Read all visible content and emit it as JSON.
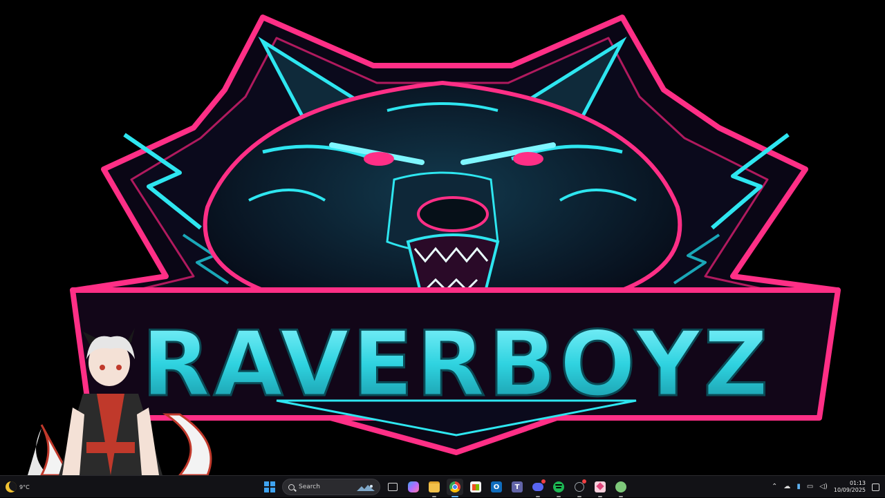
{
  "wallpaper": {
    "logo_text": "RAVERBOYZ",
    "colors": {
      "neon_pink": "#ff2f86",
      "neon_cyan": "#31e6ef",
      "background": "#000000"
    }
  },
  "taskbar": {
    "weather": {
      "temp": "9°C",
      "icon": "moon-icon"
    },
    "start_icon": "windows-logo-icon",
    "search": {
      "placeholder": "Search"
    },
    "apps": [
      {
        "name": "task-view-icon",
        "color": "#d9d9d9"
      },
      {
        "name": "copilot-icon",
        "color": "#7b6cff"
      },
      {
        "name": "file-explorer-icon",
        "color": "#f2c14a"
      },
      {
        "name": "chrome-icon",
        "color": "#34a853"
      },
      {
        "name": "microsoft-store-icon",
        "color": "#2d8cff"
      },
      {
        "name": "outlook-icon",
        "color": "#0f6cbd"
      },
      {
        "name": "teams-icon",
        "color": "#6264a7"
      },
      {
        "name": "discord-icon",
        "color": "#5865f2"
      },
      {
        "name": "spotify-icon",
        "color": "#1db954"
      },
      {
        "name": "clock-app-icon",
        "color": "#9aa0a6"
      },
      {
        "name": "paint-icon",
        "color": "#f4b6c8"
      },
      {
        "name": "xbox-icon",
        "color": "#7ec87a"
      }
    ],
    "tray": {
      "chevron_icon": "chevron-up-icon",
      "cloud_icon": "onedrive-icon",
      "mic_icon": "microphone-icon",
      "network_icon": "network-icon",
      "volume_icon": "speaker-icon",
      "time": "01:13",
      "date": "10/09/2025",
      "notification_icon": "notification-icon"
    }
  }
}
